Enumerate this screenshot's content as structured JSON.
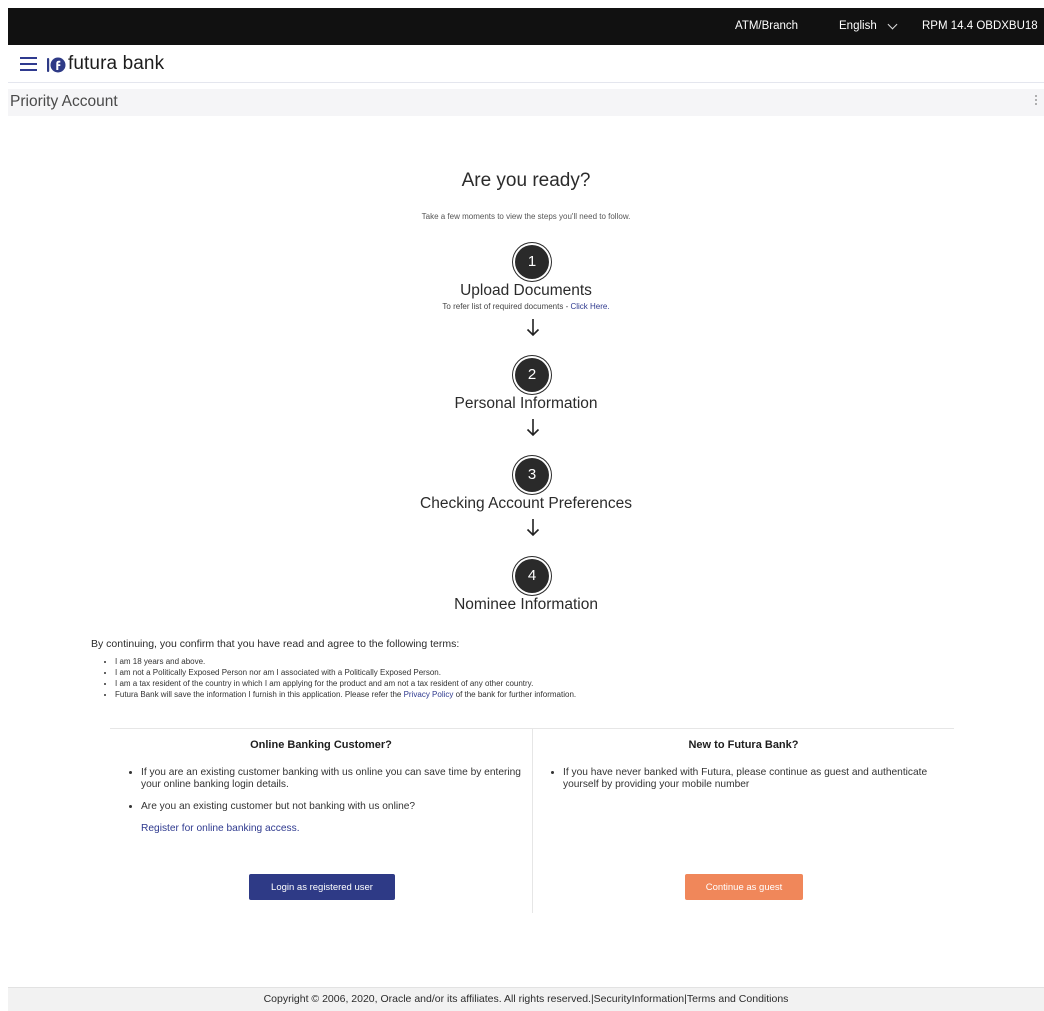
{
  "topbar": {
    "atm_branch": "ATM/Branch",
    "language": "English",
    "user": "RPM 14.4 OBDXBU18"
  },
  "brand": {
    "name": "futura bank"
  },
  "page": {
    "title": "Priority Account"
  },
  "intro": {
    "headline": "Are you ready?",
    "subline": "Take a few moments to view the steps you'll need to follow."
  },
  "steps": [
    {
      "number": "1",
      "title": "Upload Documents",
      "sub_prefix": "To refer list of required documents - ",
      "sub_link": "Click Here."
    },
    {
      "number": "2",
      "title": "Personal Information"
    },
    {
      "number": "3",
      "title": "Checking Account Preferences"
    },
    {
      "number": "4",
      "title": "Nominee Information"
    }
  ],
  "terms": {
    "intro": "By continuing, you confirm that you have read and agree to the following terms:",
    "items": [
      "I am 18 years and above.",
      "I am not a Politically Exposed Person nor am I associated with a Politically Exposed Person.",
      "I am a tax resident of the country in which I am applying for the product and am not a tax resident of any other country."
    ],
    "last_prefix": "Futura Bank will save the information I furnish in this application. Please refer the ",
    "last_link": "Privacy Policy",
    "last_suffix": " of the bank for further information."
  },
  "online_customer": {
    "heading": "Online Banking Customer?",
    "bullets": [
      "If you are an existing customer banking with us online you can save time by entering your online banking login details.",
      "Are you an existing customer but not banking with us online?"
    ],
    "register_link": "Register for online banking access.",
    "button": "Login as registered user"
  },
  "new_customer": {
    "heading": "New to Futura Bank?",
    "bullets": [
      "If you have never banked with Futura, please continue as guest and authenticate yourself by providing your mobile number"
    ],
    "button": "Continue as guest"
  },
  "footer": {
    "text": "Copyright © 2006, 2020, Oracle and/or its affiliates. All rights reserved.|SecurityInformation|Terms and Conditions"
  },
  "colors": {
    "brand_blue": "#2e3a86",
    "guest_orange": "#f0875a",
    "topbar": "#111111"
  }
}
